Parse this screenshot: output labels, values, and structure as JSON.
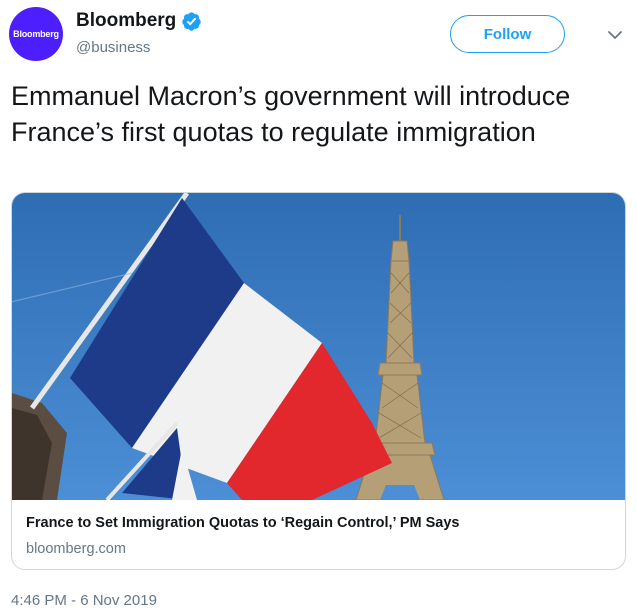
{
  "user": {
    "avatar_text": "Bloomberg",
    "display_name": "Bloomberg",
    "handle": "@business",
    "verified_icon": "verified-badge-icon"
  },
  "actions": {
    "follow_label": "Follow",
    "more_icon": "chevron-down-icon"
  },
  "tweet": {
    "text": "Emmanuel Macron’s government will introduce France’s first quotas to regulate immigration",
    "timestamp": "4:46 PM - 6 Nov 2019"
  },
  "card": {
    "title": "France to Set Immigration Quotas to ‘Regain Control,’ PM Says",
    "domain": "bloomberg.com",
    "image_icon": "french-flag-eiffel-tower-photo"
  },
  "colors": {
    "brand": "#4d1fff",
    "accent": "#1da1f2",
    "secondary_text": "#657786",
    "border": "#ccd6dd"
  }
}
